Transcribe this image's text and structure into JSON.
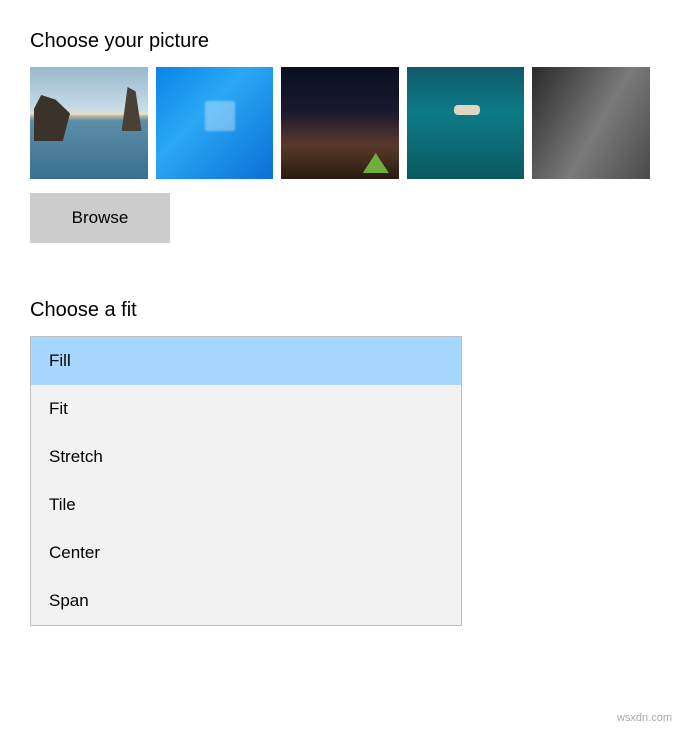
{
  "picture_section": {
    "heading": "Choose your picture",
    "thumbnails": [
      {
        "name": "beach-arch"
      },
      {
        "name": "windows-blue"
      },
      {
        "name": "night-sky-tent"
      },
      {
        "name": "underwater-swimmer"
      },
      {
        "name": "rock-cliff"
      }
    ],
    "browse_label": "Browse"
  },
  "fit_section": {
    "heading": "Choose a fit",
    "options": [
      {
        "label": "Fill",
        "selected": true
      },
      {
        "label": "Fit",
        "selected": false
      },
      {
        "label": "Stretch",
        "selected": false
      },
      {
        "label": "Tile",
        "selected": false
      },
      {
        "label": "Center",
        "selected": false
      },
      {
        "label": "Span",
        "selected": false
      }
    ]
  },
  "watermark": "wsxdn.com"
}
